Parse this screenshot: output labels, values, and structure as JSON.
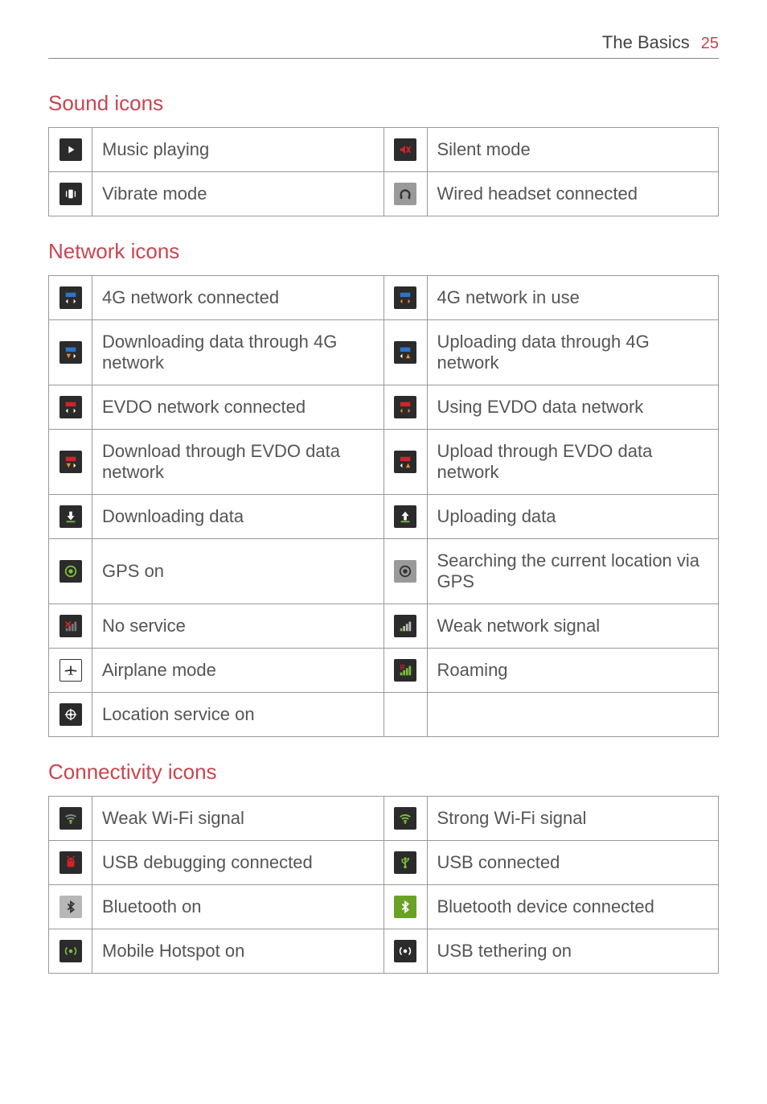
{
  "header": {
    "title": "The Basics",
    "page": "25"
  },
  "sections": {
    "sound": {
      "heading": "Sound icons",
      "rows": [
        {
          "l": "Music playing",
          "r": "Silent mode"
        },
        {
          "l": "Vibrate mode",
          "r": "Wired headset connected"
        }
      ]
    },
    "network": {
      "heading": "Network icons",
      "rows": [
        {
          "l": "4G network connected",
          "r": "4G network in use"
        },
        {
          "l": "Downloading data through 4G network",
          "r": "Uploading data through 4G network"
        },
        {
          "l": "EVDO network connected",
          "r": "Using EVDO data network"
        },
        {
          "l": "Download through EVDO data network",
          "r": "Upload through EVDO data network"
        },
        {
          "l": "Downloading data",
          "r": "Uploading data"
        },
        {
          "l": "GPS on",
          "r": "Searching the current location via GPS"
        },
        {
          "l": "No service",
          "r": "Weak network signal"
        },
        {
          "l": "Airplane mode",
          "r": "Roaming"
        },
        {
          "l": "Location service on",
          "r": ""
        }
      ]
    },
    "connectivity": {
      "heading": "Connectivity icons",
      "rows": [
        {
          "l": "Weak Wi-Fi signal",
          "r": "Strong Wi-Fi signal"
        },
        {
          "l": "USB debugging connected",
          "r": "USB connected"
        },
        {
          "l": "Bluetooth on",
          "r": "Bluetooth device connected"
        },
        {
          "l": "Mobile Hotspot on",
          "r": "USB tethering on"
        }
      ]
    }
  }
}
